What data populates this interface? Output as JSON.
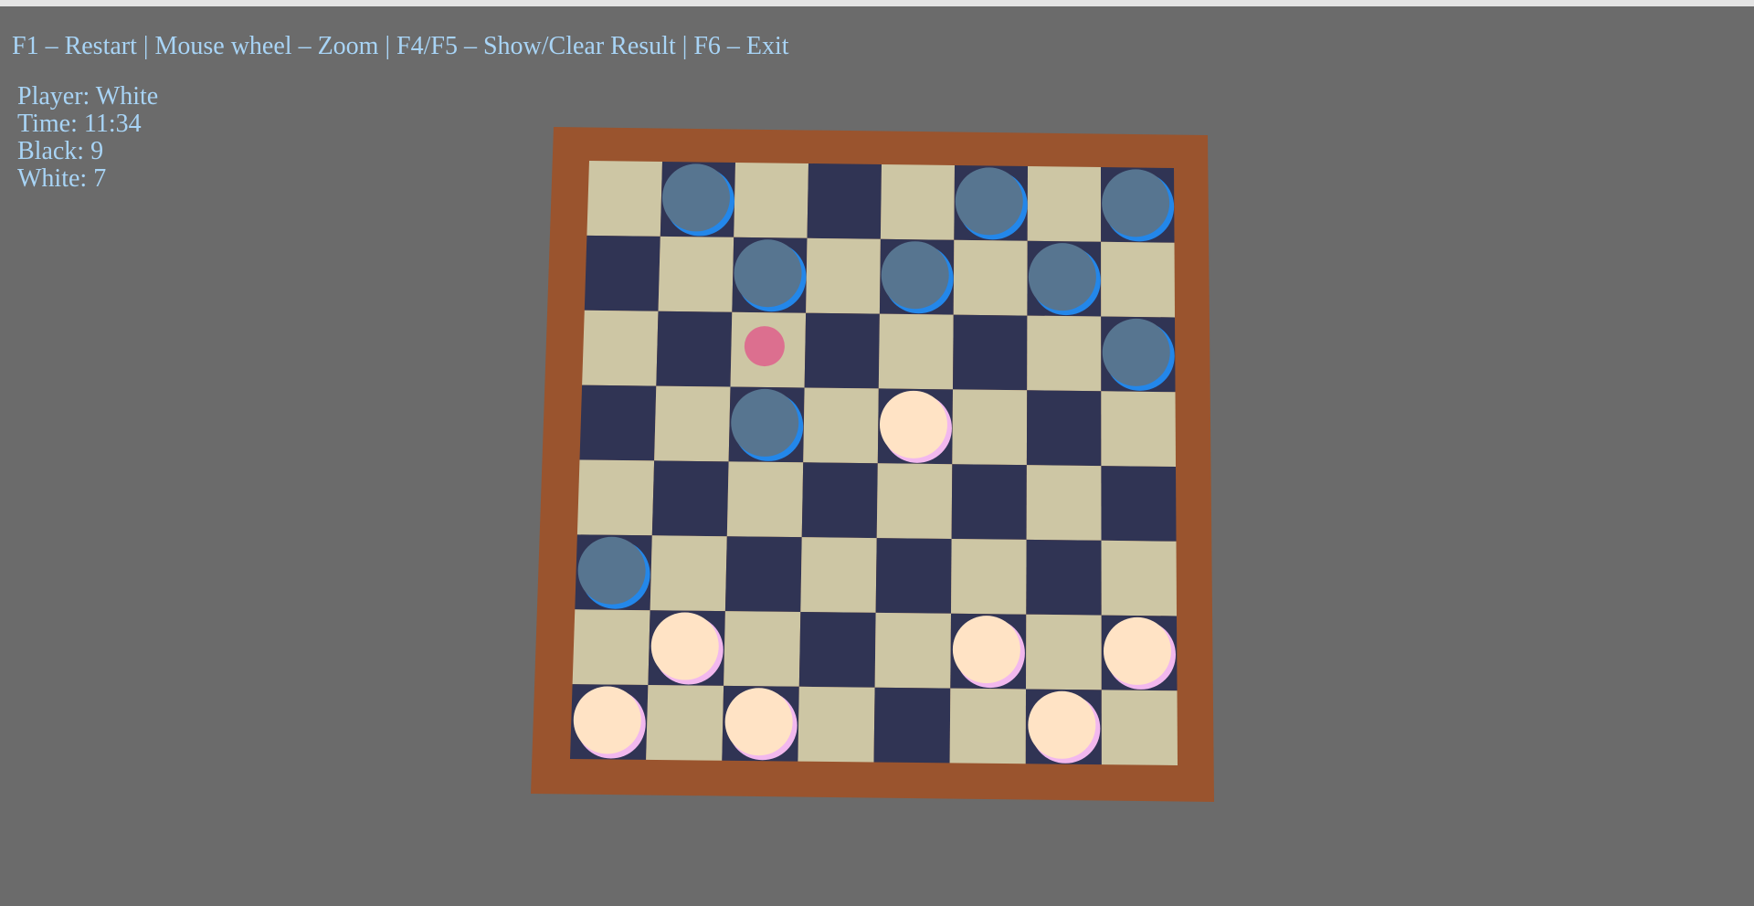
{
  "help_bar": {
    "text": "F1 – Restart | Mouse wheel – Zoom | F4/F5 – Show/Clear Result | F6 – Exit"
  },
  "status": {
    "player": "Player: White",
    "time": "Time: 11:34",
    "black": "Black: 9",
    "white": "White: 7"
  },
  "colors": {
    "background": "#6b6b6b",
    "frame": "#9a542e",
    "light_square": "#cdc6a4",
    "dark_square": "#303454",
    "black_piece": "#577590",
    "black_piece_rim": "#2387ea",
    "white_piece": "#ffe3c5",
    "white_piece_rim": "#f2b8ee",
    "move_marker": "#dc6f8f",
    "hud_text": "#a8d4f6"
  },
  "board": {
    "size": 8,
    "pieces": [
      {
        "row": 0,
        "col": 1,
        "side": "black"
      },
      {
        "row": 0,
        "col": 5,
        "side": "black"
      },
      {
        "row": 0,
        "col": 7,
        "side": "black"
      },
      {
        "row": 1,
        "col": 2,
        "side": "black"
      },
      {
        "row": 1,
        "col": 4,
        "side": "black"
      },
      {
        "row": 1,
        "col": 6,
        "side": "black"
      },
      {
        "row": 2,
        "col": 7,
        "side": "black"
      },
      {
        "row": 3,
        "col": 2,
        "side": "black"
      },
      {
        "row": 5,
        "col": 0,
        "side": "black"
      },
      {
        "row": 3,
        "col": 4,
        "side": "white"
      },
      {
        "row": 6,
        "col": 1,
        "side": "white"
      },
      {
        "row": 6,
        "col": 5,
        "side": "white"
      },
      {
        "row": 6,
        "col": 7,
        "side": "white"
      },
      {
        "row": 7,
        "col": 0,
        "side": "white"
      },
      {
        "row": 7,
        "col": 2,
        "side": "white"
      },
      {
        "row": 7,
        "col": 6,
        "side": "white"
      }
    ],
    "move_markers": [
      {
        "row": 2,
        "col": 2
      }
    ]
  }
}
